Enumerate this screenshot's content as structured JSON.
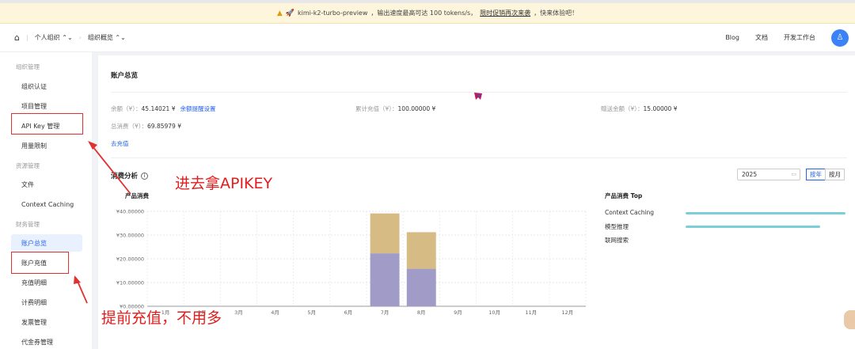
{
  "banner": {
    "model": "kimi-k2-turbo-preview",
    "text": "，输出速度最高可达 100 tokens/s，",
    "link": "限时促销再次来袭",
    "tail": "，快来体验吧！"
  },
  "header": {
    "org": "个人组织",
    "overview": "组织概览",
    "links": [
      "Blog",
      "文档",
      "开发工作台"
    ]
  },
  "sidebar": {
    "group_org": "组织管理",
    "item_auth": "组织认证",
    "item_project": "项目管理",
    "item_apikey": "API Key 管理",
    "item_limit": "用量限制",
    "group_res": "资源管理",
    "item_file": "文件",
    "item_cache": "Context Caching",
    "group_fin": "财务管理",
    "item_overview": "账户总览",
    "item_recharge": "账户充值",
    "item_recharge_detail": "充值明细",
    "item_billing": "计费明细",
    "item_invoice": "发票管理",
    "item_voucher": "代金券管理"
  },
  "account": {
    "title": "账户总览",
    "balance_label": "余额（¥）：",
    "balance_value": "45.14021 ¥",
    "balance_link": "余额提醒设置",
    "recharge_label": "累计充值（¥）：",
    "recharge_value": "100.00000 ¥",
    "gift_label": "赠送金额（¥）：",
    "gift_value": "15.00000 ¥",
    "spend_label": "总消费（¥）：",
    "spend_value": "69.85979 ¥",
    "go_recharge": "去充值"
  },
  "analysis": {
    "title": "消费分析",
    "year": "2025",
    "by_year": "按年",
    "by_month": "按月",
    "chart_title": "产品消费",
    "top_title": "产品消费 Top",
    "top_items": [
      {
        "name": "Context Caching",
        "value": 1.0
      },
      {
        "name": "模型推理",
        "value": 0.84
      },
      {
        "name": "联网搜索",
        "value": 0.0
      }
    ]
  },
  "chart_data": {
    "type": "bar",
    "title": "产品消费",
    "categories": [
      "1月",
      "2月",
      "3月",
      "4月",
      "5月",
      "6月",
      "7月",
      "8月",
      "9月",
      "10月",
      "11月",
      "12月"
    ],
    "y_tick_labels": [
      "¥0.00000",
      "¥10.00000",
      "¥20.00000",
      "¥30.00000",
      "¥40.00000"
    ],
    "ylim": [
      0,
      40
    ],
    "stacked": true,
    "series": [
      {
        "color": "#a09cc7",
        "values": [
          0,
          0,
          0,
          0,
          0,
          0,
          22.3,
          15.8,
          0,
          0,
          0,
          0
        ]
      },
      {
        "color": "#d6bc84",
        "values": [
          0,
          0,
          0,
          0,
          0,
          0,
          16.8,
          15.4,
          0,
          0,
          0,
          0
        ]
      }
    ],
    "grid": true
  },
  "annotations": {
    "apikey": "进去拿APIKEY",
    "recharge": "提前充值，不用多"
  },
  "colors": {
    "accent": "#2563eb",
    "annotation": "#e11d1d"
  }
}
